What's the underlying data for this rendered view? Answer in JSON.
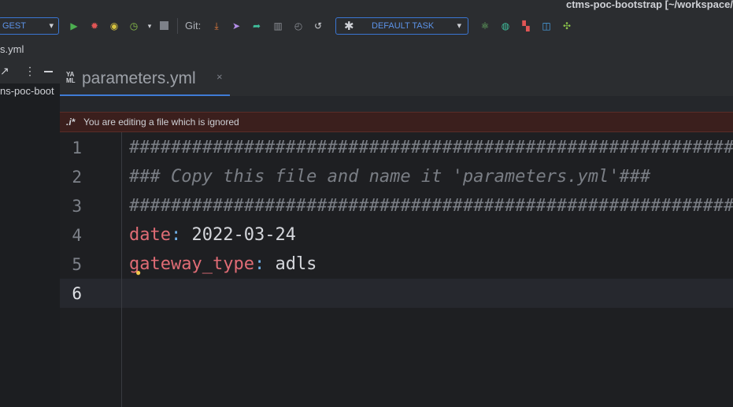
{
  "window": {
    "title": "ctms-poc-bootstrap [~/workspace/"
  },
  "toolbar": {
    "run_config_label": "GEST",
    "git_label": "Git:",
    "task_label": "DEFAULT TASK",
    "icons": [
      "run-icon",
      "debug-icon",
      "coverage-icon",
      "profile-icon",
      "stop-icon",
      "git-update-icon",
      "git-push-icon",
      "git-commit-icon",
      "compare-icon",
      "history-icon",
      "rollback-icon",
      "task-icon",
      "plugin-a-icon",
      "plugin-b-icon",
      "plugin-c-icon",
      "plugin-d-icon",
      "plugin-e-icon"
    ]
  },
  "navbar": {
    "breadcrumb": "s.yml"
  },
  "project_panel": {
    "root_label": "ns-poc-boot"
  },
  "editor": {
    "tab_label": "parameters.yml",
    "tab_icon_text": "YA ML",
    "banner_prefix": ".i*",
    "banner_text": "You are editing a file which is ignored",
    "line_numbers": [
      "1",
      "2",
      "3",
      "4",
      "5",
      "6"
    ],
    "lines": {
      "l1": "##########################################################",
      "l2": "### Copy this file and name it 'parameters.yml'###",
      "l3": "##########################################################",
      "l4_key": "date",
      "l4_colon": ":",
      "l4_val": " 2022-03-24",
      "l5_key": "gateway_type",
      "l5_colon": ":",
      "l5_val": " adls"
    }
  },
  "colors": {
    "accent": "#3a76d3",
    "comment": "#7a7e85",
    "key": "#e06c75",
    "banner_bg": "#3b1f1d"
  }
}
